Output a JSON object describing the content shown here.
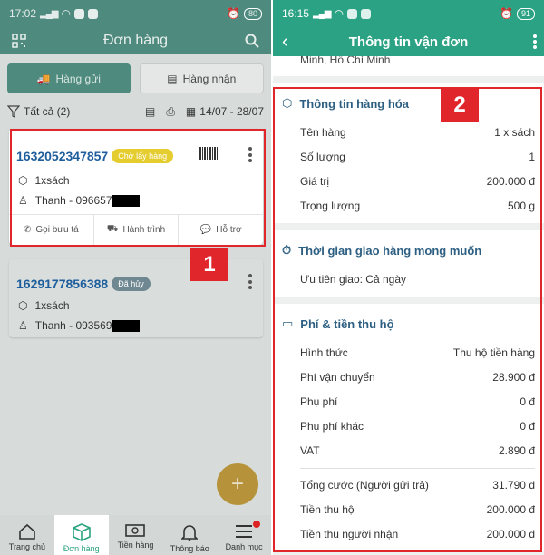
{
  "left": {
    "status": {
      "time": "17:02",
      "battery": "80"
    },
    "header": {
      "title": "Đơn hàng"
    },
    "tabs": [
      {
        "label": "Hàng gửi"
      },
      {
        "label": "Hàng nhận"
      }
    ],
    "filter": {
      "label": "Tất cả (2)",
      "date_range": "14/07 - 28/07"
    },
    "orders": [
      {
        "number": "1632052347857",
        "status": "Chờ lấy hàng",
        "item": "1xsách",
        "contact": "Thanh - 096657"
      },
      {
        "number": "1629177856388",
        "status": "Đã hủy",
        "item": "1xsách",
        "contact": "Thanh - 093569"
      }
    ],
    "card_actions": [
      {
        "label": "Gọi bưu tá"
      },
      {
        "label": "Hành trình"
      },
      {
        "label": "Hỗ trợ"
      }
    ],
    "fab_label": "+",
    "bottom_nav": [
      {
        "label": "Trang chủ"
      },
      {
        "label": "Đơn hàng"
      },
      {
        "label": "Tiền hàng"
      },
      {
        "label": "Thông báo"
      },
      {
        "label": "Danh mục"
      }
    ]
  },
  "right": {
    "status": {
      "time": "16:15",
      "battery": "91"
    },
    "header": {
      "title": "Thông tin vận đơn"
    },
    "address_tail": "Minh, Hồ Chí Minh",
    "goods": {
      "title": "Thông tin hàng hóa",
      "rows": [
        {
          "label": "Tên hàng",
          "value": "1 x sách"
        },
        {
          "label": "Số lượng",
          "value": "1"
        },
        {
          "label": "Giá trị",
          "value": "200.000 đ"
        },
        {
          "label": "Trọng lượng",
          "value": "500 g"
        }
      ]
    },
    "delivery": {
      "title": "Thời gian giao hàng mong muốn",
      "text": "Ưu tiên giao: Cả ngày"
    },
    "fees": {
      "title": "Phí & tiền thu hộ",
      "rows": [
        {
          "label": "Hình thức",
          "value": "Thu hộ tiền hàng"
        },
        {
          "label": "Phí vận chuyển",
          "value": "28.900 đ"
        },
        {
          "label": "Phụ phí",
          "value": "0 đ"
        },
        {
          "label": "Phụ phí khác",
          "value": "0 đ"
        },
        {
          "label": "VAT",
          "value": "2.890 đ"
        }
      ],
      "totals": [
        {
          "label": "Tổng cước (Người gửi trả)",
          "value": "31.790 đ"
        },
        {
          "label": "Tiền thu hộ",
          "value": "200.000 đ"
        },
        {
          "label": "Tiền thu người nhận",
          "value": "200.000 đ"
        }
      ]
    }
  },
  "annotations": {
    "label_1": "1",
    "label_2": "2"
  }
}
